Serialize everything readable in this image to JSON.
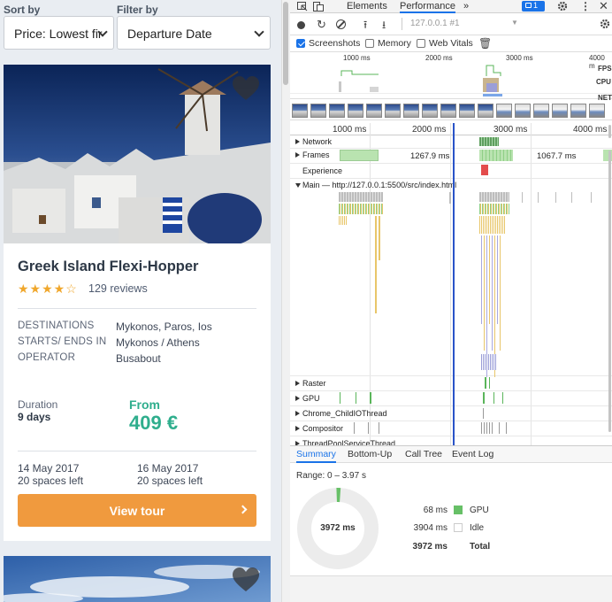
{
  "filters": {
    "sort_label": "Sort by",
    "sort_value": "Price: Lowest fir",
    "filter_label": "Filter by",
    "filter_value": "Departure Date"
  },
  "tour": {
    "title": "Greek Island Flexi-Hopper",
    "rating_stars": "★★★★☆",
    "rating": 4.5,
    "reviews": "129 reviews",
    "details": [
      {
        "key": "DESTINATIONS",
        "value": "Mykonos, Paros, Ios"
      },
      {
        "key": "STARTS/ ENDS IN",
        "value": "Mykonos / Athens"
      },
      {
        "key": "OPERATOR",
        "value": "Busabout"
      }
    ],
    "duration_label": "Duration",
    "duration_value": "9 days",
    "price_label": "From",
    "price": "409 €",
    "dates": [
      {
        "date": "14 May 2017",
        "spaces": "20 spaces left"
      },
      {
        "date": "16 May 2017",
        "spaces": "20 spaces left"
      }
    ],
    "cta": "View tour"
  },
  "devtools": {
    "tabs": [
      "Elements",
      "Performance",
      "»"
    ],
    "active_tab": "Performance",
    "issues_badge": "1",
    "url": "127.0.0.1 #1",
    "options": [
      {
        "label": "Screenshots",
        "checked": true
      },
      {
        "label": "Memory",
        "checked": false
      },
      {
        "label": "Web Vitals",
        "checked": false
      }
    ],
    "overview_ticks": [
      "1000 ms",
      "2000 ms",
      "3000 ms",
      "4000 m"
    ],
    "overview_labels": [
      "FPS",
      "CPU",
      "NET"
    ],
    "ruler_ticks": [
      "1000 ms",
      "2000 ms",
      "3000 ms",
      "4000 ms"
    ],
    "tracks": {
      "network": "Network",
      "frames": "Frames",
      "frame_time_1": "1267.9 ms",
      "frame_time_2": "1067.7 ms",
      "experience": "Experience",
      "main": "Main — http://127.0.0.1:5500/src/index.html",
      "raster": "Raster",
      "gpu": "GPU",
      "child_io": "Chrome_ChildIOThread",
      "compositor": "Compositor",
      "threadpool": "ThreadPoolServiceThread"
    },
    "bottom_tabs": [
      "Summary",
      "Bottom-Up",
      "Call Tree",
      "Event Log"
    ],
    "active_bottom_tab": "Summary",
    "range": "Range: 0 – 3.97 s",
    "donut_total": "3972 ms",
    "summary": [
      {
        "value": "68 ms",
        "label": "GPU",
        "color": "#67c067"
      },
      {
        "value": "3904 ms",
        "label": "Idle",
        "color": "#ffffff"
      },
      {
        "value": "3972 ms",
        "label": "Total",
        "color": ""
      }
    ]
  }
}
